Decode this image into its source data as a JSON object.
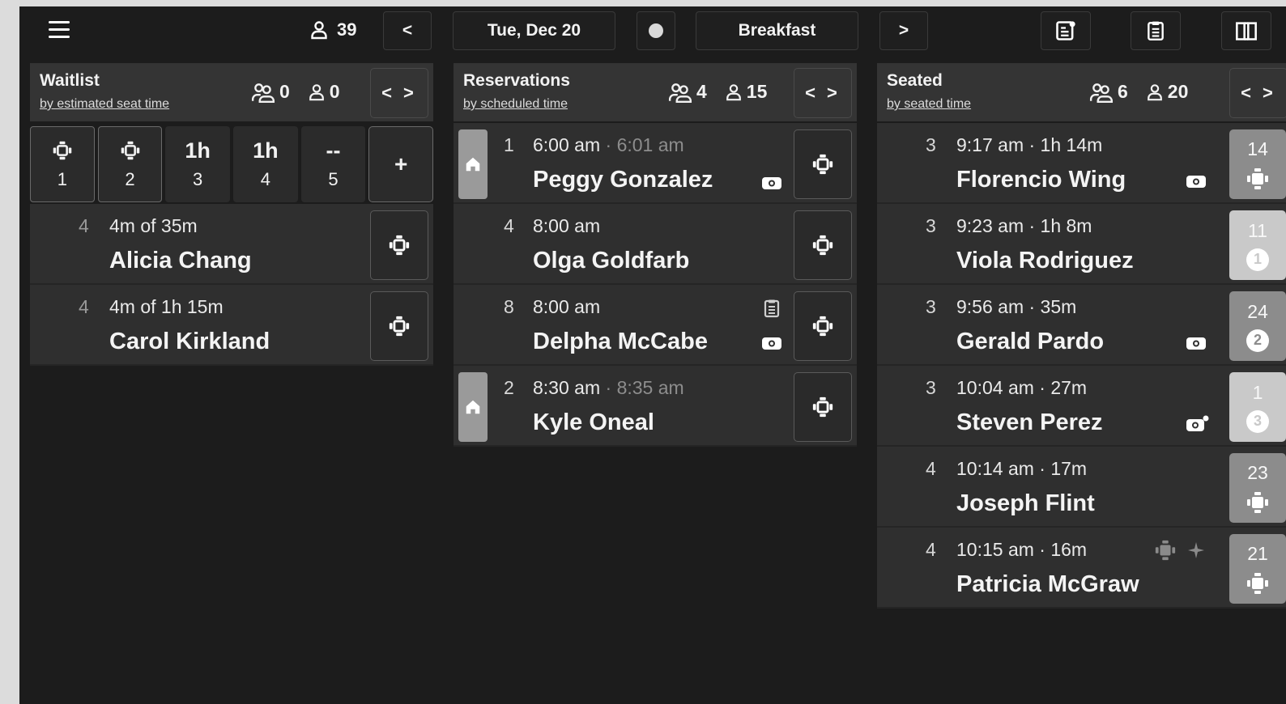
{
  "header": {
    "total_covers": "39",
    "prev_label": "<",
    "date": "Tue, Dec 20",
    "meal": "Breakfast",
    "next_label": ">"
  },
  "waitlist": {
    "title": "Waitlist",
    "subtitle": "by estimated seat time",
    "parties": "0",
    "covers": "0",
    "toggle": "< >",
    "add_label": "+",
    "slots": [
      {
        "top": "",
        "num": "1"
      },
      {
        "top": "",
        "num": "2"
      },
      {
        "top": "1h",
        "num": "3"
      },
      {
        "top": "1h",
        "num": "4"
      },
      {
        "top": "--",
        "num": "5"
      }
    ],
    "rows": [
      {
        "party": "4",
        "time": "4m of 35m",
        "name": "Alicia Chang"
      },
      {
        "party": "4",
        "time": "4m of 1h 15m",
        "name": "Carol Kirkland"
      }
    ]
  },
  "reservations": {
    "title": "Reservations",
    "subtitle": "by scheduled time",
    "parties": "4",
    "covers": "15",
    "toggle": "< >",
    "rows": [
      {
        "party": "1",
        "time": "6:00 am",
        "sep": " · ",
        "arrived": "6:01 am",
        "name": "Peggy Gonzalez"
      },
      {
        "party": "4",
        "time": "8:00 am",
        "sep": "",
        "arrived": "",
        "name": "Olga Goldfarb"
      },
      {
        "party": "8",
        "time": "8:00 am",
        "sep": "",
        "arrived": "",
        "name": "Delpha McCabe"
      },
      {
        "party": "2",
        "time": "8:30 am",
        "sep": " · ",
        "arrived": "8:35 am",
        "name": "Kyle Oneal"
      }
    ]
  },
  "seated": {
    "title": "Seated",
    "subtitle": "by seated time",
    "parties": "6",
    "covers": "20",
    "toggle": "< >",
    "rows": [
      {
        "party": "3",
        "time": "9:17 am · 1h 14m",
        "name": "Florencio Wing",
        "table": "14",
        "badge": ""
      },
      {
        "party": "3",
        "time": "9:23 am · 1h 8m",
        "name": "Viola Rodriguez",
        "table": "11",
        "badge": "1"
      },
      {
        "party": "3",
        "time": "9:56 am · 35m",
        "name": "Gerald Pardo",
        "table": "24",
        "badge": "2"
      },
      {
        "party": "3",
        "time": "10:04 am · 27m",
        "name": "Steven Perez",
        "table": "1",
        "badge": "3"
      },
      {
        "party": "4",
        "time": "10:14 am · 17m",
        "name": "Joseph Flint",
        "table": "23",
        "badge": ""
      },
      {
        "party": "4",
        "time": "10:15 am · 16m",
        "name": "Patricia McGraw",
        "table": "21",
        "badge": ""
      }
    ]
  }
}
